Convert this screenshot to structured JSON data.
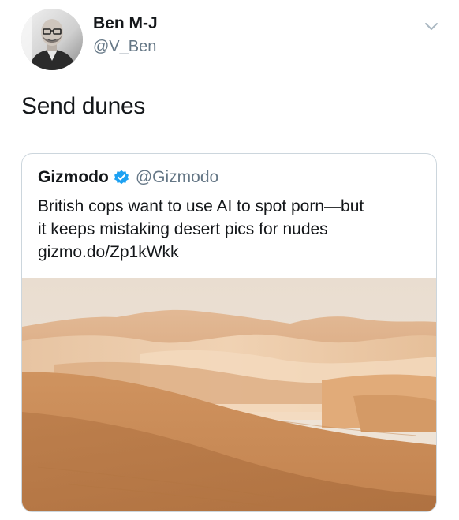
{
  "tweet": {
    "author": {
      "name": "Ben M-J",
      "handle": "@V_Ben"
    },
    "text": "Send dunes",
    "more_icon": "chevron-down-icon"
  },
  "quoted_tweet": {
    "author": {
      "name": "Gizmodo",
      "handle": "@Gizmodo",
      "verified": true
    },
    "text_lines": [
      "British cops want to use AI to spot porn—but",
      "it keeps mistaking desert pics for nudes"
    ],
    "link": "gizmo.do/Zp1kWkk",
    "media": "desert-dunes-photo"
  },
  "colors": {
    "text_primary": "#14171a",
    "text_secondary": "#657786",
    "border": "#ccd6dd",
    "verified_blue": "#1da1f2",
    "sand": "#d29b6a"
  }
}
